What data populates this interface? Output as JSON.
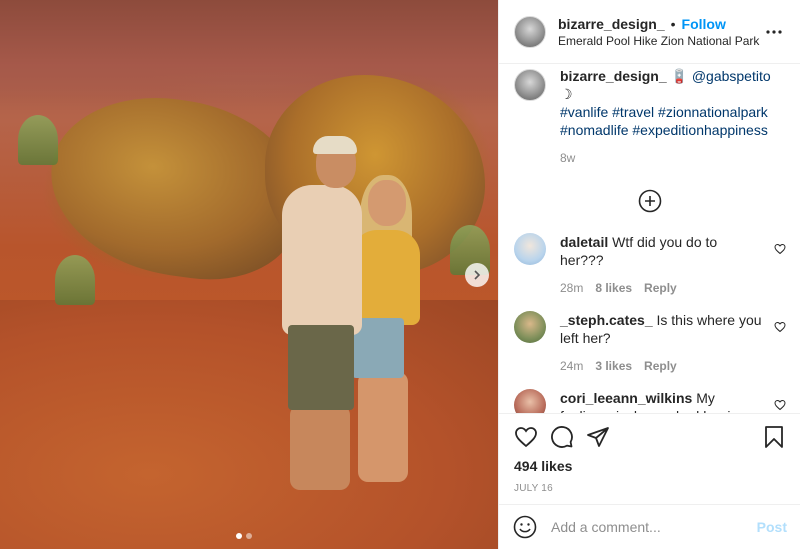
{
  "header": {
    "username": "bizarre_design_",
    "separator": "•",
    "follow_label": "Follow",
    "location": "Emerald Pool Hike Zion National Park",
    "more_icon": "more-horizontal-icon"
  },
  "caption": {
    "username": "bizarre_design_",
    "mention_prefix": "🪫",
    "mention": "@gabspetito",
    "moon": "☽",
    "hashtags": "#vanlife #travel #zionnationalpark #nomadlife #expeditionhappiness",
    "time": "8w"
  },
  "comments": [
    {
      "username": "daletail",
      "text": "Wtf did you do to her???",
      "time": "28m",
      "likes": "8 likes",
      "reply": "Reply",
      "avatar_color": "#a5c3e0"
    },
    {
      "username": "_steph.cates_",
      "text": "Is this where you left her?",
      "time": "24m",
      "likes": "3 likes",
      "reply": "Reply",
      "avatar_color": "#8a9a6a"
    },
    {
      "username": "cori_leeann_wilkins",
      "text": "My feelings, is, he pushed her in one of those",
      "time": "",
      "likes": "",
      "reply": "",
      "avatar_color": "#c08a7a"
    }
  ],
  "actions": {
    "likes": "494 likes",
    "date": "JULY 16"
  },
  "add_comment": {
    "placeholder": "Add a comment...",
    "post_label": "Post"
  },
  "carousel": {
    "current": 1,
    "total": 2
  }
}
